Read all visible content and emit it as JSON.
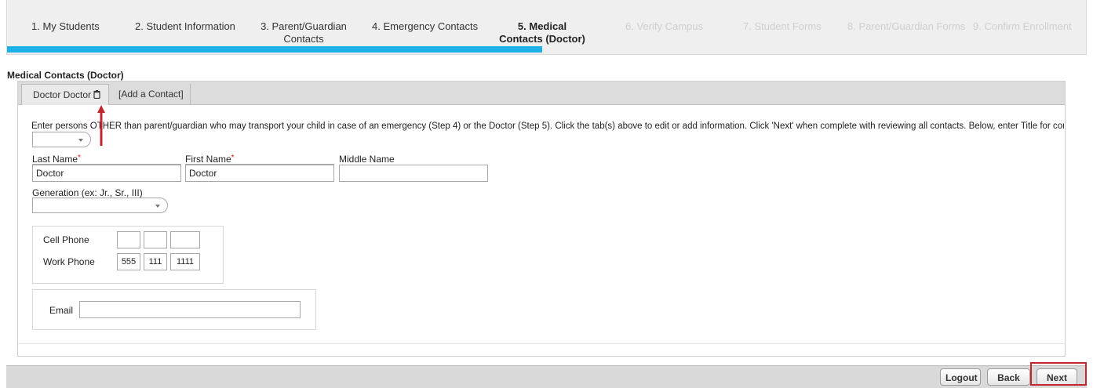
{
  "wizard": {
    "steps": [
      {
        "label": "1. My Students",
        "state": "done"
      },
      {
        "label": "2. Student Information",
        "state": "done"
      },
      {
        "label": "3. Parent/Guardian Contacts",
        "state": "done"
      },
      {
        "label": "4. Emergency Contacts",
        "state": "done"
      },
      {
        "label": "5. Medical Contacts (Doctor)",
        "state": "active"
      },
      {
        "label": "6. Verify Campus",
        "state": "disabled"
      },
      {
        "label": "7. Student Forms",
        "state": "disabled"
      },
      {
        "label": "8. Parent/Guardian Forms",
        "state": "disabled"
      },
      {
        "label": "9. Confirm Enrollment",
        "state": "disabled"
      }
    ],
    "accent_color": "#1cb0e6"
  },
  "section_title": "Medical Contacts (Doctor)",
  "tabs": {
    "contact_tab": "Doctor Doctor",
    "contact_tab_icon": "trash-icon",
    "add_tab": "[Add a Contact]"
  },
  "instructions": "Enter persons OTHER than parent/guardian who may transport your child in case of an emergency (Step 4) or the Doctor (Step 5). Click the tab(s) above to edit or add information. Click 'Next' when complete with reviewing all contacts. Below, enter Title for conta",
  "form": {
    "title_select": "",
    "last_name_label": "Last Name",
    "last_name_value": "Doctor",
    "first_name_label": "First Name",
    "first_name_value": "Doctor",
    "middle_name_label": "Middle Name",
    "middle_name_value": "",
    "generation_label": "Generation (ex: Jr., Sr., III)",
    "generation_value": "",
    "cell_phone_label": "Cell Phone",
    "cell_phone": [
      "",
      "",
      ""
    ],
    "work_phone_label": "Work Phone",
    "work_phone": [
      "555",
      "111",
      "1111"
    ],
    "email_label": "Email",
    "email_value": ""
  },
  "footer": {
    "logout": "Logout",
    "back": "Back",
    "next": "Next"
  },
  "annotation_color": "#c1272d"
}
